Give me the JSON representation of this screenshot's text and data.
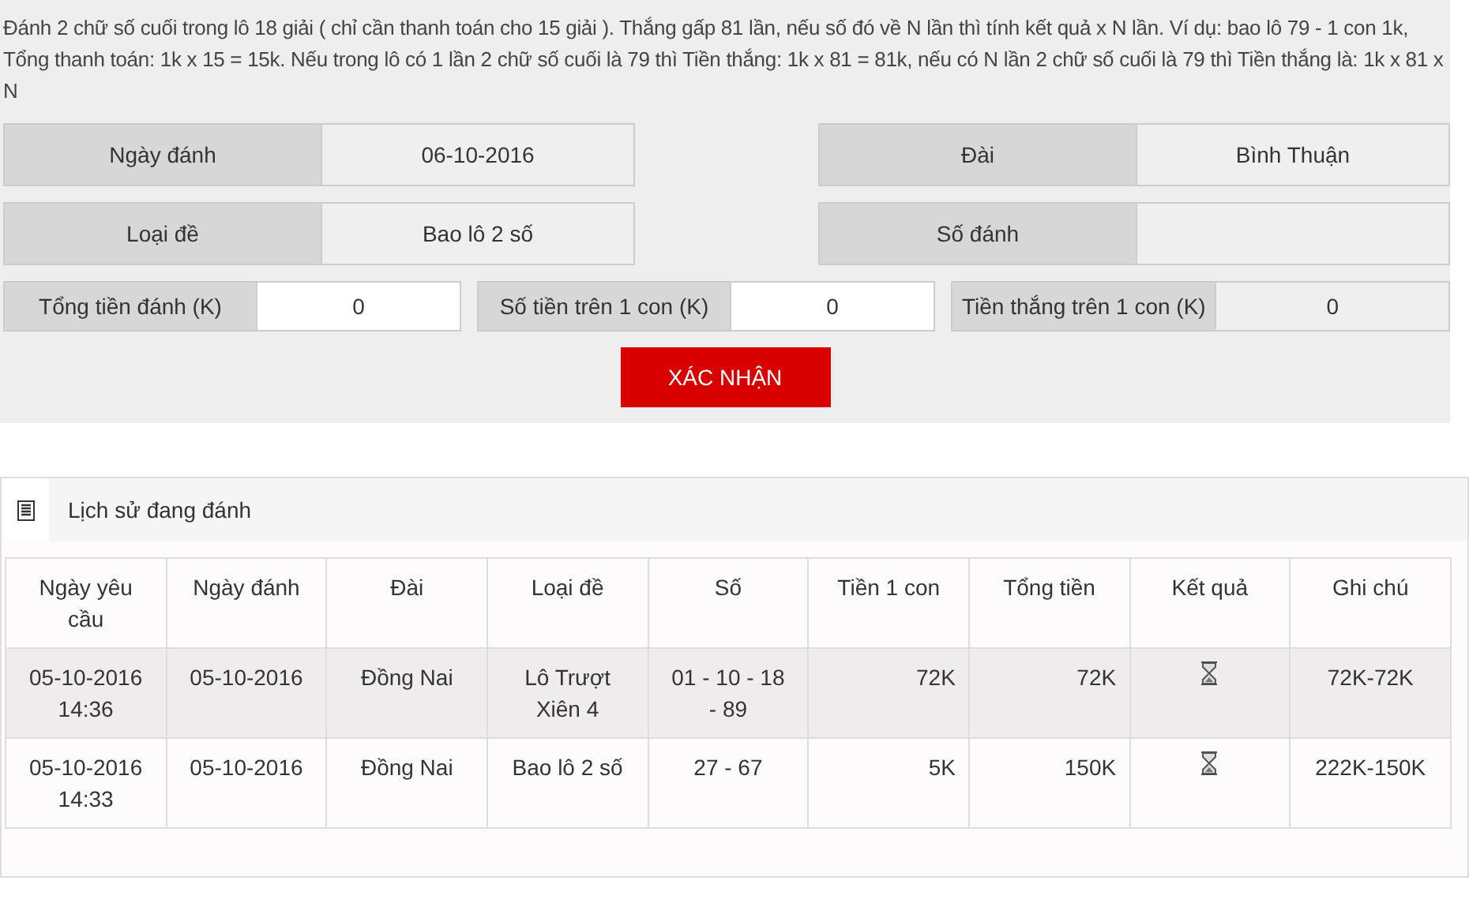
{
  "intro": "Đánh 2 chữ số cuối trong lô 18 giải ( chỉ cần thanh toán cho 15 giải ). Thắng gấp 81 lần, nếu số đó về N lần thì tính kết quả x N lần. Ví dụ: bao lô 79 - 1 con 1k, Tổng thanh toán: 1k x 15 = 15k. Nếu trong lô có 1 lần 2 chữ số cuối là 79 thì Tiền thắng: 1k x 81 = 81k, nếu có N lần 2 chữ số cuối là 79 thì Tiền thắng là: 1k x 81 x N",
  "form_rows": [
    [
      {
        "label": "Ngày đánh",
        "value": "06-10-2016"
      },
      {
        "label": "Đài",
        "value": "Bình Thuận"
      }
    ],
    [
      {
        "label": "Loại đề",
        "value": "Bao lô 2 số"
      },
      {
        "label": "Số đánh"
      }
    ]
  ],
  "amounts": [
    {
      "label": "Tổng tiền đánh (K)",
      "value": "0",
      "kind": "input"
    },
    {
      "label": "Số tiền trên 1 con (K)",
      "value": "0",
      "kind": "input"
    },
    {
      "label": "Tiền thắng trên 1 con (K)",
      "value": "0",
      "kind": "readonly"
    }
  ],
  "confirm_button": "XÁC NHẬN",
  "history": {
    "title": "Lịch sử đang đánh",
    "table": {
      "columns": [
        "Ngày yêu cầu",
        "Ngày đánh",
        "Đài",
        "Loại đề",
        "Số",
        "Tiền 1 con",
        "Tổng tiền",
        "Kết quả",
        "Ghi chú"
      ],
      "rows": [
        {
          "selected": true,
          "requested": "05-10-2016 14:36",
          "date": "05-10-2016",
          "station": "Đồng Nai",
          "type": "Lô Trượt Xiên 4",
          "numbers": "01 - 10 - 18 - 89",
          "per_unit": "72K",
          "total": "72K",
          "pending": true,
          "note": "72K-72K"
        },
        {
          "selected": false,
          "requested": "05-10-2016 14:33",
          "date": "05-10-2016",
          "station": "Đồng Nai",
          "type": "Bao lô 2 số",
          "numbers": "27 - 67",
          "per_unit": "5K",
          "total": "150K",
          "pending": true,
          "note": "222K-150K"
        }
      ]
    }
  }
}
